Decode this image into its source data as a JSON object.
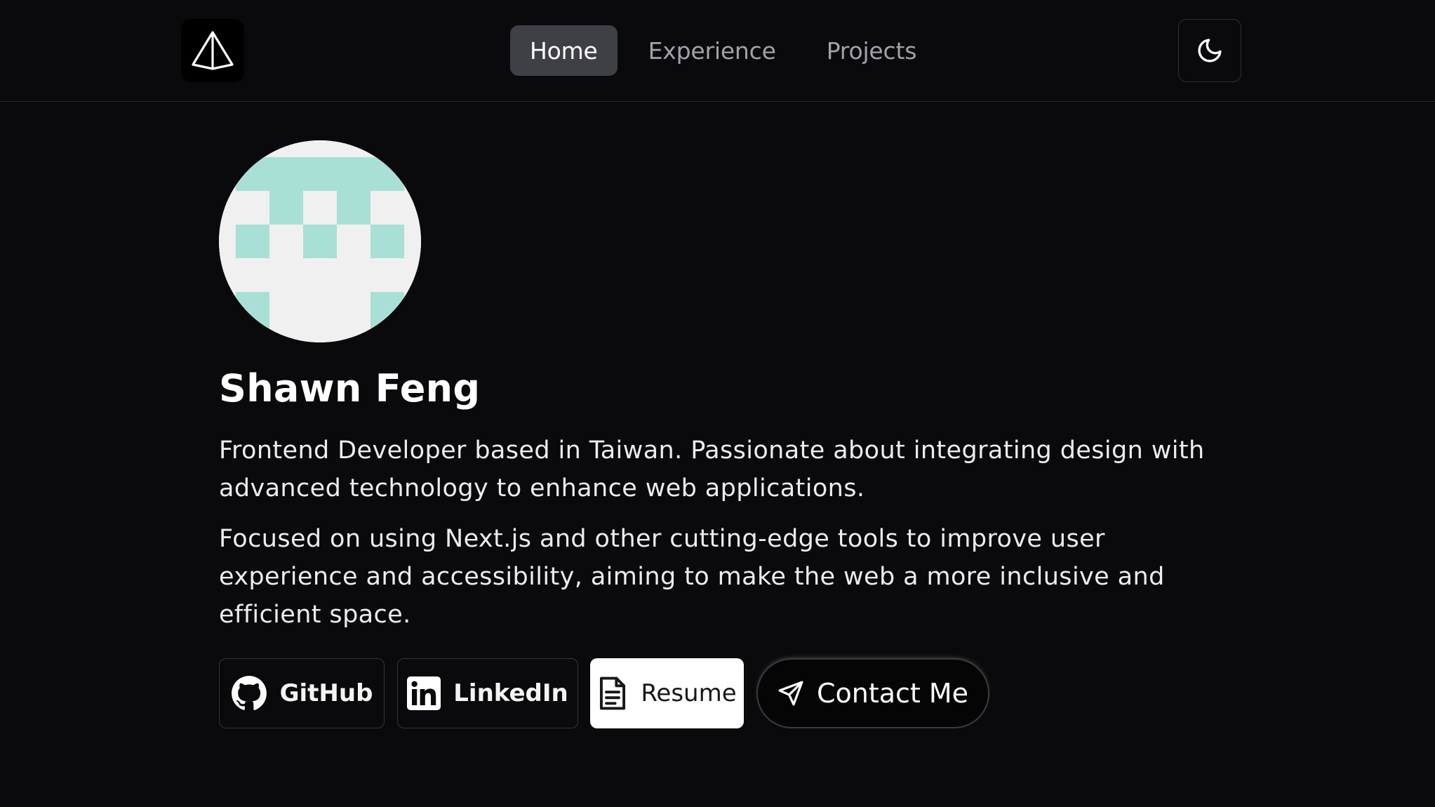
{
  "header": {
    "logo_icon": "pyramid-logo-icon",
    "nav": [
      {
        "label": "Home",
        "active": true
      },
      {
        "label": "Experience",
        "active": false
      },
      {
        "label": "Projects",
        "active": false
      }
    ],
    "theme_toggle_icon": "moon-icon"
  },
  "hero": {
    "avatar_icon": "pixel-identicon-avatar",
    "avatar_colors": {
      "primary": "#a8e0d6",
      "background": "#f0f0f0"
    },
    "name": "Shawn Feng",
    "paragraphs": [
      "Frontend Developer based in Taiwan. Passionate about integrating design with advanced technology to enhance web applications.",
      "Focused on using Next.js and other cutting-edge tools to improve user experience and accessibility, aiming to make the web a more inclusive and efficient space."
    ]
  },
  "buttons": {
    "github": {
      "label": "GitHub",
      "icon": "github-icon"
    },
    "linkedin": {
      "label": "LinkedIn",
      "icon": "linkedin-icon"
    },
    "resume": {
      "label": "Resume",
      "icon": "document-icon"
    },
    "contact": {
      "label": "Contact Me",
      "icon": "send-icon"
    }
  },
  "colors": {
    "background": "#0a0a0c",
    "nav_active_bg": "#3f3f46",
    "text_muted": "#a1a1aa"
  }
}
